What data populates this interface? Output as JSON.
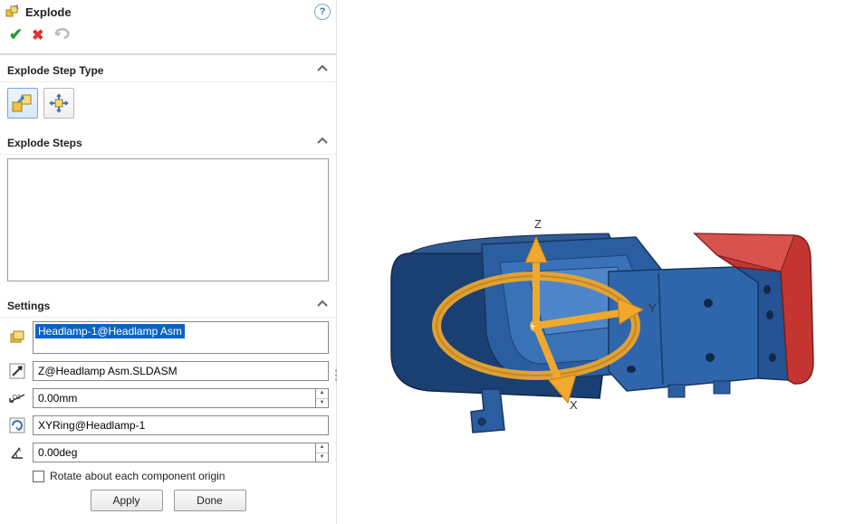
{
  "header": {
    "title": "Explode"
  },
  "sections": {
    "step_type": "Explode Step Type",
    "steps": "Explode Steps",
    "settings": "Settings"
  },
  "settings": {
    "component": "Headlamp-1@Headlamp Asm",
    "direction": "Z@Headlamp Asm.SLDASM",
    "distance": "0.00mm",
    "ring": "XYRing@Headlamp-1",
    "angle": "0.00deg",
    "rotate_about": "Rotate about each component origin"
  },
  "buttons": {
    "apply": "Apply",
    "done": "Done"
  },
  "viewport": {
    "axes": {
      "x": "X",
      "y": "Y",
      "z": "Z"
    }
  }
}
